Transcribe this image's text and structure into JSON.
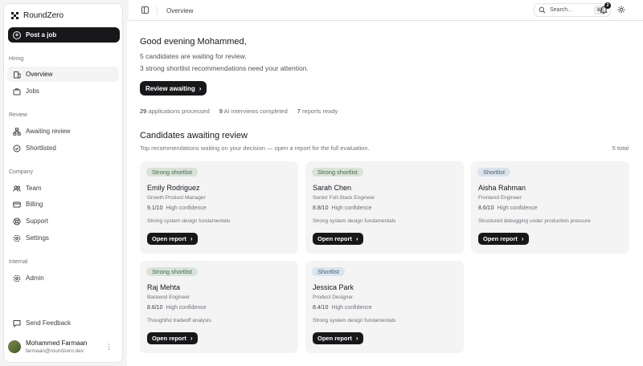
{
  "app": {
    "name": "RoundZero"
  },
  "sidebar": {
    "post_label": "Post a job",
    "sections": {
      "hiring": "Hiring",
      "review": "Review",
      "company": "Company",
      "internal": "Internal"
    },
    "items": {
      "overview": "Overview",
      "jobs": "Jobs",
      "awaiting_review": "Awaiting review",
      "shortlisted": "Shortlisted",
      "team": "Team",
      "billing": "Billing",
      "support": "Support",
      "settings": "Settings",
      "admin": "Admin",
      "send_feedback": "Send Feedback"
    },
    "user": {
      "name": "Mohammed Farmaan",
      "email": "farmaan@roundzero.dev"
    }
  },
  "topbar": {
    "breadcrumb": "Overview",
    "search_label": "Search...",
    "search_shortcut": "⌘K",
    "notifications_count": "2"
  },
  "main": {
    "greeting": "Good evening Mohammed,",
    "line1": "5 candidates are waiting for review.",
    "line2": "3 strong shortlist recommendations need your attention.",
    "review_button": "Review awaiting",
    "stats": [
      {
        "value": "29",
        "label": "applications processed"
      },
      {
        "value": "9",
        "label": "AI interviews completed"
      },
      {
        "value": "7",
        "label": "reports ready"
      }
    ],
    "section_title": "Candidates awaiting review",
    "section_subtitle": "Top recommendations waiting on your decision — open a report for the full evaluation.",
    "section_total": "5 total",
    "open_report_label": "Open report",
    "candidates": [
      {
        "tag": "Strong shortlist",
        "name": "Emily Rodriguez",
        "role": "Growth Product Manager",
        "score": "9.1/10",
        "confidence": "High confidence",
        "note": "Strong system design fundamentals"
      },
      {
        "tag": "Strong shortlist",
        "name": "Sarah Chen",
        "role": "Senior Full-Stack Engineer",
        "score": "8.8/10",
        "confidence": "High confidence",
        "note": "Strong system design fundamentals"
      },
      {
        "tag": "Shortlist",
        "name": "Aisha Rahman",
        "role": "Frontend Engineer",
        "score": "8.6/10",
        "confidence": "High confidence",
        "note": "Structured debugging under production pressure"
      },
      {
        "tag": "Strong shortlist",
        "name": "Raj Mehta",
        "role": "Backend Engineer",
        "score": "8.6/10",
        "confidence": "High confidence",
        "note": "Thoughtful tradeoff analysis"
      },
      {
        "tag": "Shortlist",
        "name": "Jessica Park",
        "role": "Product Designer",
        "score": "8.4/10",
        "confidence": "High confidence",
        "note": "Strong system design fundamentals"
      }
    ]
  },
  "colors": {
    "primary": "#18181b",
    "strong_pill_bg": "#d9e3d8",
    "strong_pill_text": "#3f6b46",
    "shortlist_pill_bg": "#dbe4ec",
    "shortlist_pill_text": "#43607a"
  }
}
